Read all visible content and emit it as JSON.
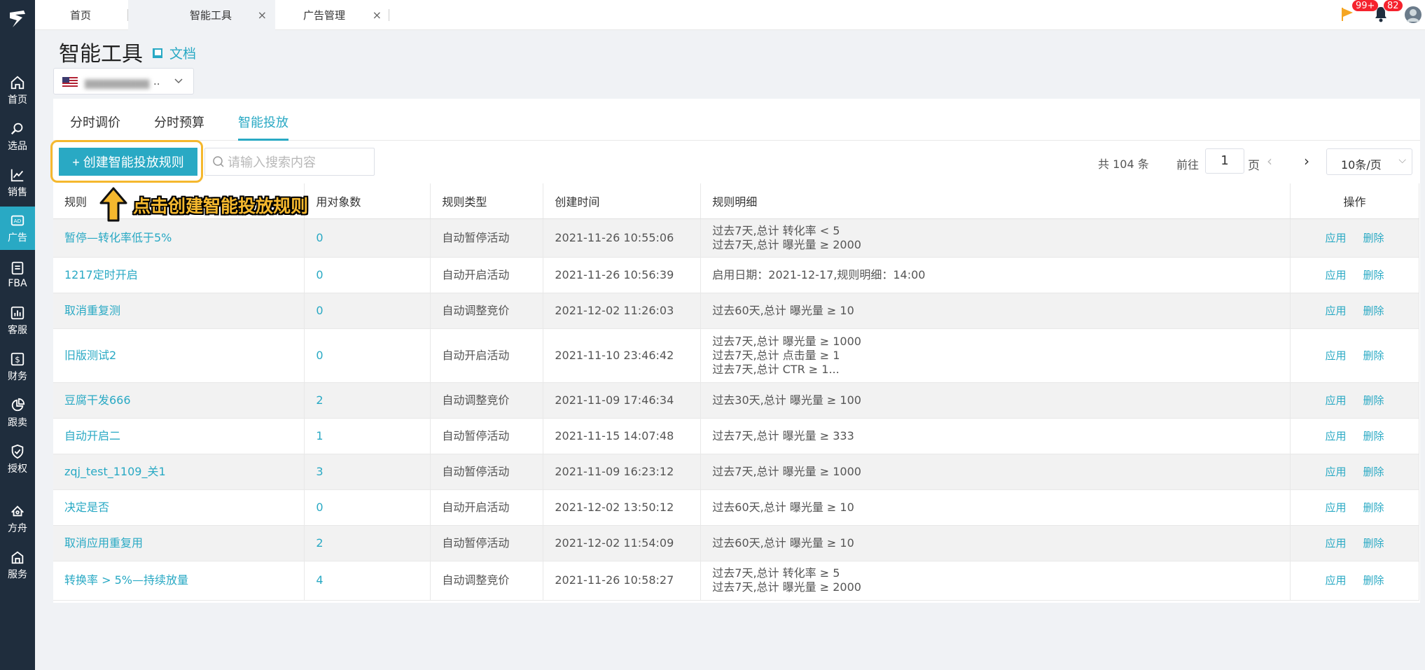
{
  "sidebar": {
    "items": [
      {
        "label": "首页",
        "icon": "home-icon"
      },
      {
        "label": "选品",
        "icon": "search-icon"
      },
      {
        "label": "销售",
        "icon": "trend-chart-icon"
      },
      {
        "label": "广告",
        "icon": "ad-icon"
      },
      {
        "label": "FBA",
        "icon": "building-icon"
      },
      {
        "label": "客服",
        "icon": "bar-chart-icon"
      },
      {
        "label": "财务",
        "icon": "dollar-icon"
      },
      {
        "label": "跟卖",
        "icon": "pie-chart-icon"
      },
      {
        "label": "授权",
        "icon": "shield-icon"
      },
      {
        "label": "方舟",
        "icon": "ark-icon"
      },
      {
        "label": "服务",
        "icon": "service-icon"
      }
    ]
  },
  "topbar": {
    "tabs": [
      "首页",
      "智能工具",
      "广告管理"
    ],
    "notif_badge_1": "99+",
    "notif_badge_2": "82"
  },
  "header": {
    "title": "智能工具",
    "doc_link": "文档",
    "store_suffix": ".."
  },
  "subtabs": [
    "分时调价",
    "分时预算",
    "智能投放"
  ],
  "toolbar": {
    "create_label": "+ 创建智能投放规则",
    "search_placeholder": "请输入搜索内容",
    "total": "共 104 条",
    "goto": "前往",
    "page": "1",
    "page_unit": "页",
    "page_size": "10条/页"
  },
  "annotation": {
    "text": "点击创建智能投放规则"
  },
  "table": {
    "headers": [
      "规则",
      "用对象数",
      "规则类型",
      "创建时间",
      "规则明细",
      "操作"
    ],
    "apply": "应用",
    "delete": "删除",
    "rows": [
      {
        "name": "暂停—转化率低于5%",
        "count": "0",
        "type": "自动暂停活动",
        "time": "2021-11-26 10:55:06",
        "detail": [
          "过去7天,总计  转化率 < 5",
          "过去7天,总计  曝光量 ≥ 2000"
        ]
      },
      {
        "name": "1217定时开启",
        "count": "0",
        "type": "自动开启活动",
        "time": "2021-11-26 10:56:39",
        "detail": [
          "启用日期：2021-12-17,规则明细：14:00"
        ]
      },
      {
        "name": "取消重复测",
        "count": "0",
        "type": "自动调整竞价",
        "time": "2021-12-02 11:26:03",
        "detail": [
          "过去60天,总计  曝光量 ≥ 10"
        ]
      },
      {
        "name": "旧版测试2",
        "count": "0",
        "type": "自动开启活动",
        "time": "2021-11-10 23:46:42",
        "detail": [
          "过去7天,总计  曝光量 ≥ 1000",
          "过去7天,总计  点击量 ≥ 1",
          "过去7天,总计  CTR ≥ 1..."
        ]
      },
      {
        "name": "豆腐干发666",
        "count": "2",
        "type": "自动调整竞价",
        "time": "2021-11-09 17:46:34",
        "detail": [
          "过去30天,总计  曝光量 ≥ 100"
        ]
      },
      {
        "name": "自动开启二",
        "count": "1",
        "type": "自动暂停活动",
        "time": "2021-11-15 14:07:48",
        "detail": [
          "过去7天,总计  曝光量 ≥ 333"
        ]
      },
      {
        "name": "zqj_test_1109_关1",
        "count": "3",
        "type": "自动暂停活动",
        "time": "2021-11-09 16:23:12",
        "detail": [
          "过去7天,总计  曝光量 ≥ 1000"
        ]
      },
      {
        "name": "决定是否",
        "count": "0",
        "type": "自动开启活动",
        "time": "2021-12-02 13:50:12",
        "detail": [
          "过去60天,总计  曝光量 ≥ 10"
        ]
      },
      {
        "name": "取消应用重复用",
        "count": "2",
        "type": "自动暂停活动",
        "time": "2021-12-02 11:54:09",
        "detail": [
          "过去60天,总计  曝光量 ≥ 10"
        ]
      },
      {
        "name": "转换率 > 5%—持续放量",
        "count": "4",
        "type": "自动调整竞价",
        "time": "2021-11-26 10:58:27",
        "detail": [
          "过去7天,总计  转化率 ≥ 5",
          "过去7天,总计  曝光量 ≥ 2000"
        ]
      }
    ]
  },
  "colors": {
    "accent": "#29a9c4",
    "sidebar": "#1f2d3d",
    "highlight": "#f5b82e"
  }
}
